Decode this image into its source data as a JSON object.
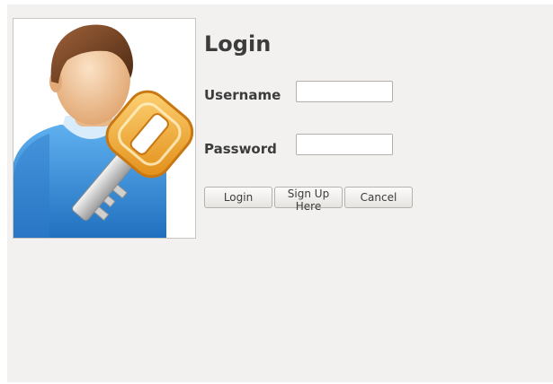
{
  "form": {
    "title": "Login",
    "username_label": "Username",
    "password_label": "Password",
    "username_value": "",
    "password_value": ""
  },
  "buttons": {
    "login": "Login",
    "signup": "Sign Up Here",
    "cancel": "Cancel"
  },
  "icons": {
    "avatar": "user-with-key-icon"
  },
  "colors": {
    "window_bg": "#f2f1f0",
    "shirt": "#3d8fd6",
    "key": "#f0a52c"
  }
}
